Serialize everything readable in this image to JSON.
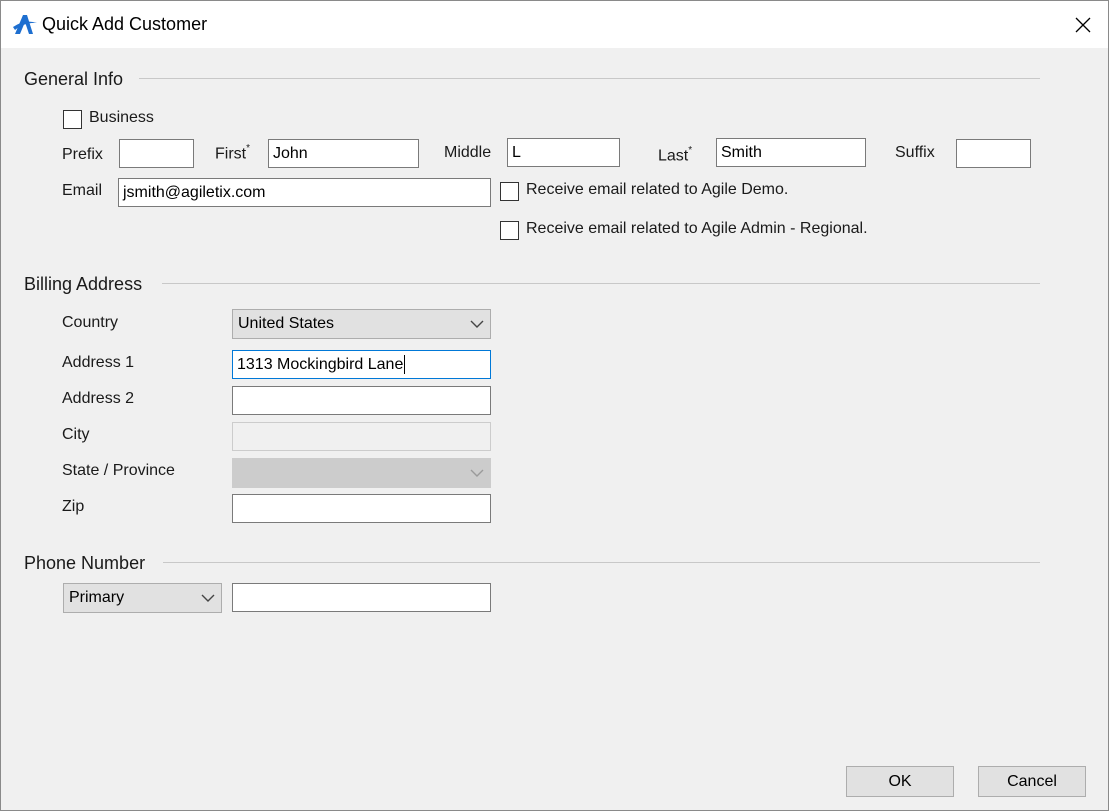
{
  "window": {
    "title": "Quick Add Customer"
  },
  "general_info": {
    "title": "General Info",
    "business_label": "Business",
    "prefix_label": "Prefix",
    "prefix_value": "",
    "first_label": "First",
    "first_value": "John",
    "middle_label": "Middle",
    "middle_value": "L",
    "last_label": "Last",
    "last_value": "Smith",
    "suffix_label": "Suffix",
    "suffix_value": "",
    "required_mark": "*",
    "email_label": "Email",
    "email_value": "jsmith@agiletix.com",
    "email_opt_demo": "Receive email related to Agile Demo.",
    "email_opt_regional": "Receive email related to Agile Admin - Regional."
  },
  "billing": {
    "title": "Billing Address",
    "country_label": "Country",
    "country_value": "United States",
    "address1_label": "Address 1",
    "address1_value": "1313 Mockingbird Lane",
    "address2_label": "Address 2",
    "address2_value": "",
    "city_label": "City",
    "city_value": "",
    "state_label": "State / Province",
    "state_value": "",
    "zip_label": "Zip",
    "zip_value": ""
  },
  "phone": {
    "title": "Phone Number",
    "type_value": "Primary",
    "number_value": ""
  },
  "footer": {
    "ok_label": "OK",
    "cancel_label": "Cancel"
  },
  "colors": {
    "accent": "#0078d7",
    "logo": "#1e6fd0"
  }
}
